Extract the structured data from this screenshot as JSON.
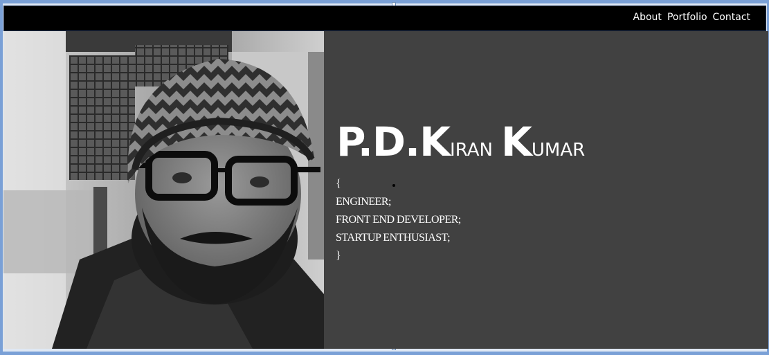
{
  "nav": {
    "links": [
      "About",
      "Portfolio",
      "Contact"
    ]
  },
  "profile": {
    "photo_alt": "profile-photo",
    "name": {
      "part1": "P.D.",
      "k1": "K",
      "part2": "IRAN",
      "k2": "K",
      "part3": "UMAR"
    },
    "code_lines": [
      "{",
      "ENGINEER;",
      "FRONT END DEVELOPER;",
      "STARTUP ENTHUSIAST;",
      "}"
    ]
  },
  "colors": {
    "navbar": "#000000",
    "panel": "#414141",
    "text": "#ffffff",
    "frame": "#7aa0d6"
  }
}
